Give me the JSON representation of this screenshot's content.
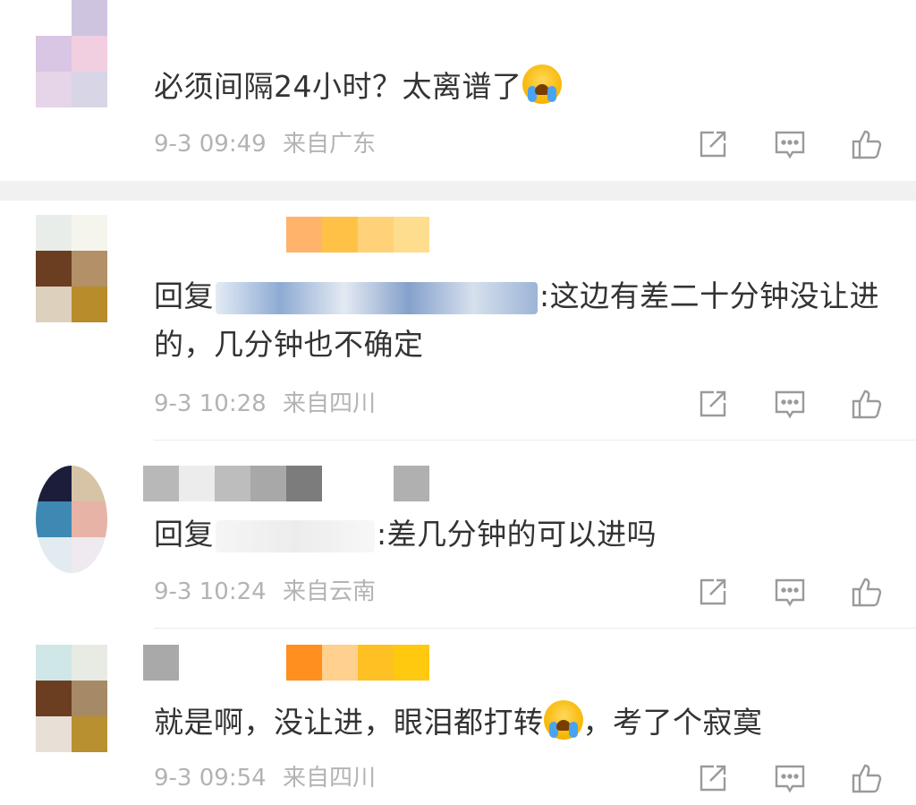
{
  "comments": [
    {
      "text": "必须间隔24小时？太离谱了",
      "emoji": "crying-face",
      "time": "9-3 09:49",
      "location": "来自广东"
    },
    {
      "reply_prefix": "回复",
      "reply_suffix": ":这边有差二十分钟没让进的，几分钟也不确定",
      "time": "9-3 10:28",
      "location": "来自四川"
    },
    {
      "reply_prefix": "回复",
      "reply_suffix": ":差几分钟的可以进吗",
      "time": "9-3 10:24",
      "location": "来自云南"
    },
    {
      "text_before": "就是啊，没让进，眼泪都打转",
      "emoji": "crying-face",
      "text_after": "，考了个寂寞",
      "time": "9-3 09:54",
      "location": "来自四川"
    }
  ],
  "icons": {
    "share": "share-icon",
    "reply": "comment-icon",
    "like": "thumbs-up-icon"
  },
  "colors": {
    "text": "#333333",
    "meta": "#b3b3b3",
    "icon": "#9a9a9a",
    "divider": "#f1f1f1"
  }
}
